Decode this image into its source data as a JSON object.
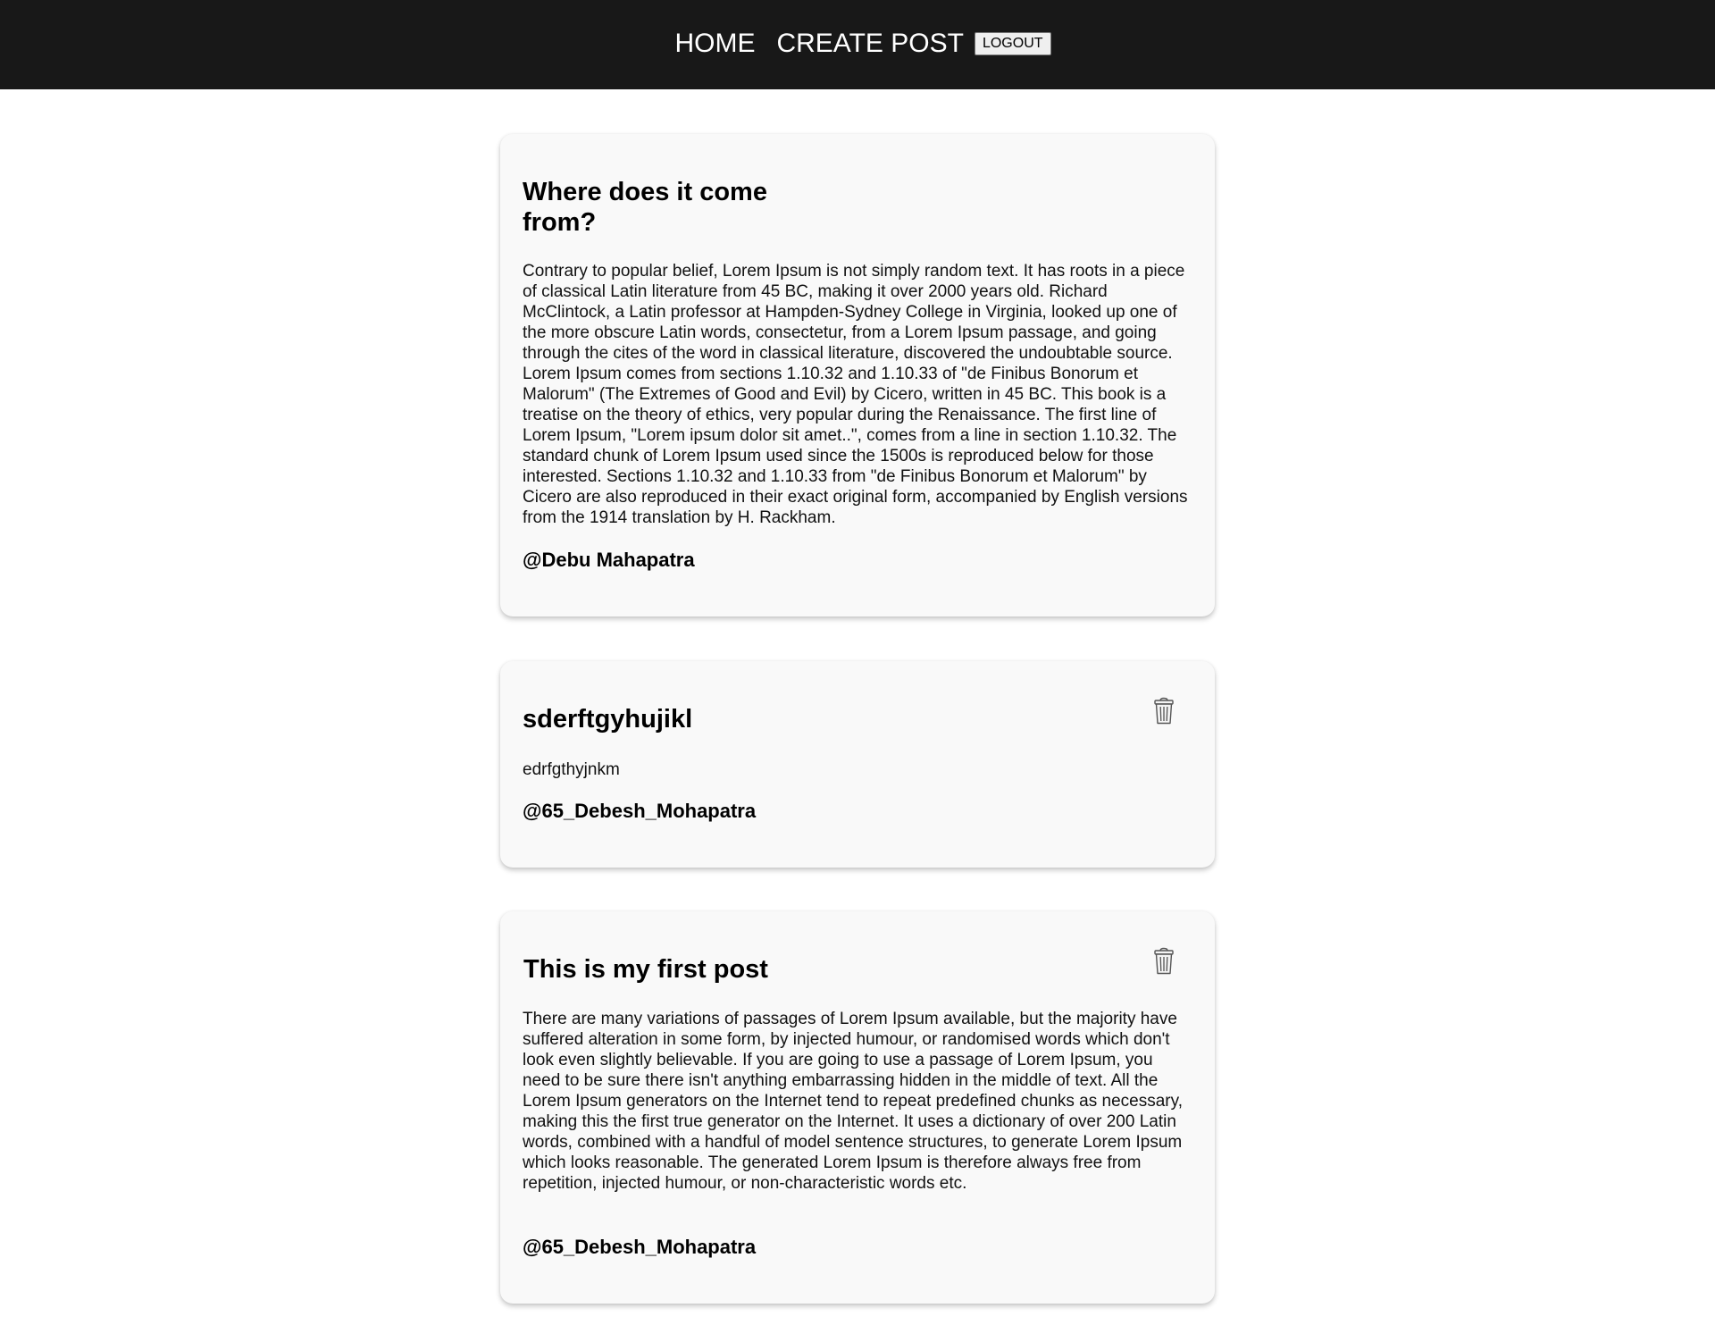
{
  "nav": {
    "home": "HOME",
    "create_post": "CREATE POST",
    "logout": "LOGOUT"
  },
  "posts": [
    {
      "title": "Where does it come from?",
      "text": "Contrary to popular belief, Lorem Ipsum is not simply random text. It has roots in a piece of classical Latin literature from 45 BC, making it over 2000 years old. Richard McClintock, a Latin professor at Hampden-Sydney College in Virginia, looked up one of the more obscure Latin words, consectetur, from a Lorem Ipsum passage, and going through the cites of the word in classical literature, discovered the undoubtable source. Lorem Ipsum comes from sections 1.10.32 and 1.10.33 of \"de Finibus Bonorum et Malorum\" (The Extremes of Good and Evil) by Cicero, written in 45 BC. This book is a treatise on the theory of ethics, very popular during the Renaissance. The first line of Lorem Ipsum, \"Lorem ipsum dolor sit amet..\", comes from a line in section 1.10.32. The standard chunk of Lorem Ipsum used since the 1500s is reproduced below for those interested. Sections 1.10.32 and 1.10.33 from \"de Finibus Bonorum et Malorum\" by Cicero are also reproduced in their exact original form, accompanied by English versions from the 1914 translation by H. Rackham.",
      "author": "@Debu Mahapatra",
      "deletable": false
    },
    {
      "title": "sderftgyhujikl",
      "text": "edrfgthyjnkm",
      "author": "@65_Debesh_Mohapatra",
      "deletable": true,
      "delete_icon": "trash-icon"
    },
    {
      "title": "This is my first post",
      "text": "There are many variations of passages of Lorem Ipsum available, but the majority have suffered alteration in some form, by injected humour, or randomised words which don't look even slightly believable. If you are going to use a passage of Lorem Ipsum, you need to be sure there isn't anything embarrassing hidden in the middle of text. All the Lorem Ipsum generators on the Internet tend to repeat predefined chunks as necessary, making this the first true generator on the Internet. It uses a dictionary of over 200 Latin words, combined with a handful of model sentence structures, to generate Lorem Ipsum which looks reasonable. The generated Lorem Ipsum is therefore always free from repetition, injected humour, or non-characteristic words etc.",
      "author": "@65_Debesh_Mohapatra",
      "deletable": true,
      "delete_icon": "trash-icon"
    }
  ],
  "colors": {
    "navbar_bg": "#181818",
    "nav_text": "#ffffff",
    "card_bg": "#f9f9f9",
    "page_bg": "#ffffff"
  }
}
